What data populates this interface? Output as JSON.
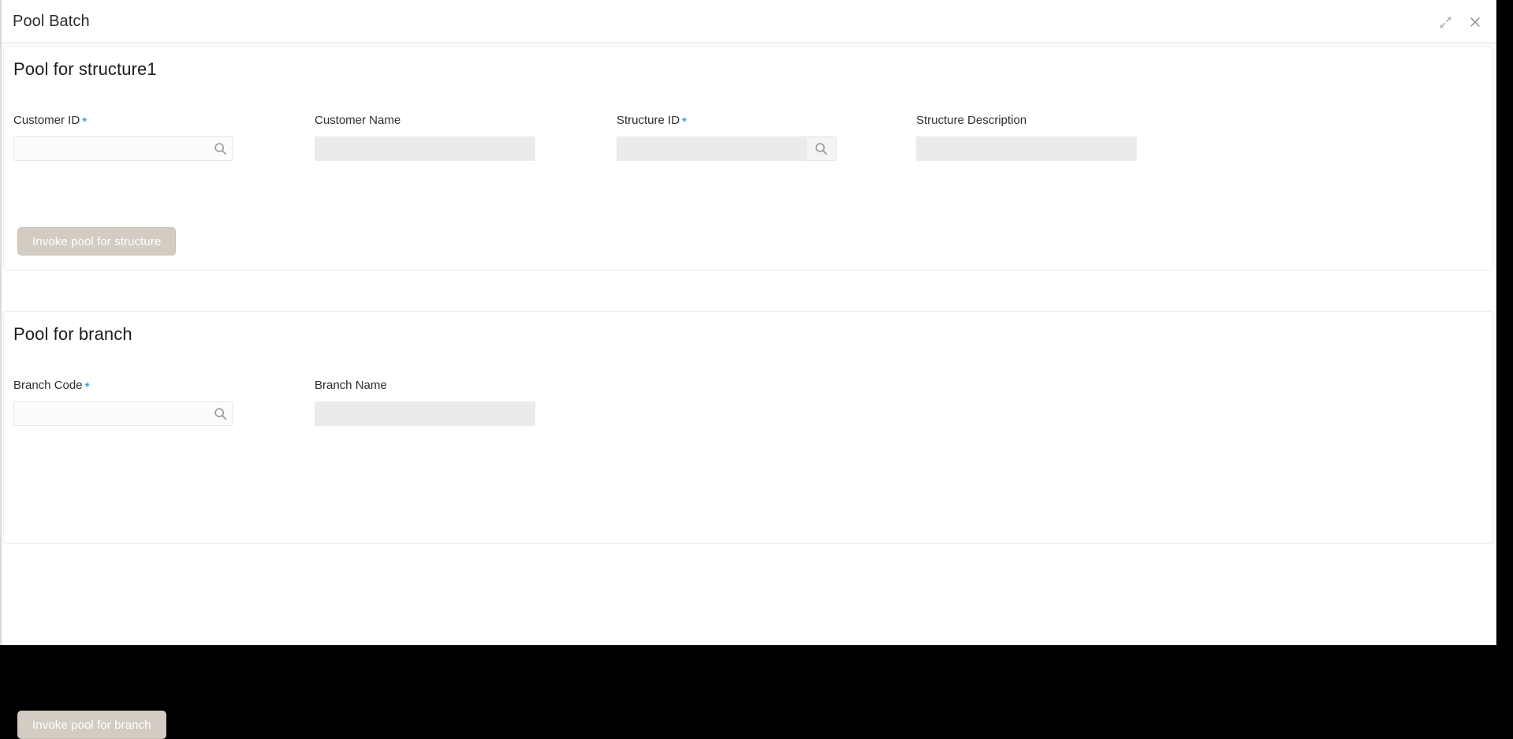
{
  "window": {
    "title": "Pool Batch",
    "collapse_icon": "collapse-arrows-icon",
    "close_icon": "close-icon"
  },
  "theme": {
    "accent_required": "#3aa7e0",
    "button_disabled_bg": "#d2ccc2",
    "button_disabled_text": "#ffffff",
    "field_disabled_bg": "#ebebeb",
    "page_bg": "#ffffff",
    "border": "#eceaea"
  },
  "sections": [
    {
      "id": "pool-for-structure",
      "title": "Pool for structure1",
      "fields": [
        {
          "name": "customer-id",
          "label": "Customer ID",
          "required": true,
          "required_marker": "*",
          "value": "",
          "placeholder": "",
          "state": "enabled",
          "control": "search-input",
          "icon": "search-icon"
        },
        {
          "name": "customer-name",
          "label": "Customer Name",
          "required": false,
          "required_marker": "",
          "value": "",
          "placeholder": "",
          "state": "disabled",
          "control": "text-input",
          "icon": ""
        },
        {
          "name": "structure-id",
          "label": "Structure ID",
          "required": true,
          "required_marker": "*",
          "value": "",
          "placeholder": "",
          "state": "disabled",
          "control": "lov-input",
          "icon": "search-icon"
        },
        {
          "name": "structure-description",
          "label": "Structure Description",
          "required": false,
          "required_marker": "",
          "value": "",
          "placeholder": "",
          "state": "disabled",
          "control": "text-input",
          "icon": ""
        }
      ],
      "action": {
        "name": "invoke-pool-for-structure",
        "label": "Invoke pool for structure",
        "state": "disabled"
      }
    },
    {
      "id": "pool-for-branch",
      "title": "Pool for branch",
      "fields": [
        {
          "name": "branch-code",
          "label": "Branch Code",
          "required": true,
          "required_marker": "*",
          "value": "",
          "placeholder": "",
          "state": "enabled",
          "control": "search-input",
          "icon": "search-icon"
        },
        {
          "name": "branch-name",
          "label": "Branch Name",
          "required": false,
          "required_marker": "",
          "value": "",
          "placeholder": "",
          "state": "disabled",
          "control": "text-input",
          "icon": ""
        }
      ],
      "action": {
        "name": "invoke-pool-for-branch",
        "label": "Invoke pool for branch",
        "state": "disabled"
      }
    }
  ]
}
